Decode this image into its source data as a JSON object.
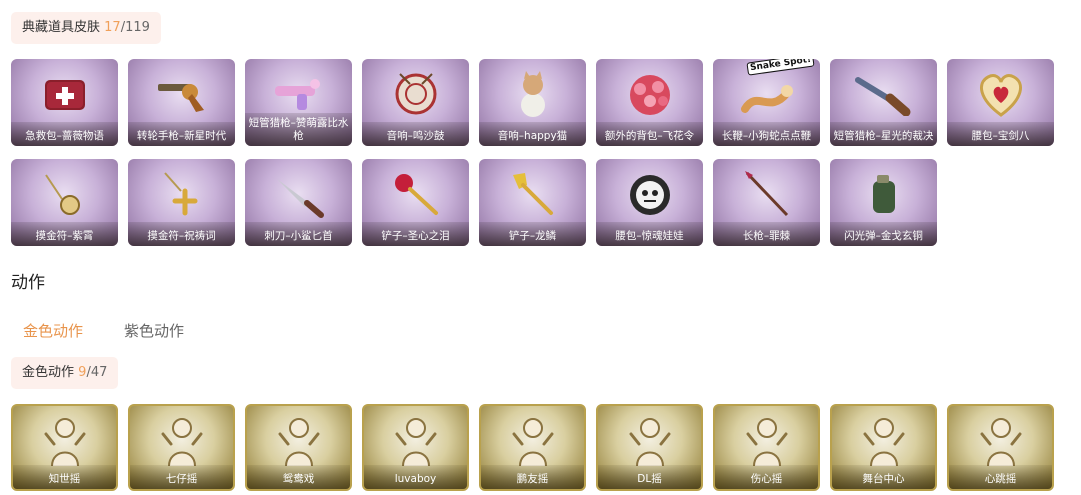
{
  "skins": {
    "title": "典藏道具皮肤",
    "count_current": "17",
    "count_total": "119",
    "row1": [
      {
        "label": "急救包–蔷薇物语",
        "icon": "first-aid-kit-icon"
      },
      {
        "label": "转轮手枪–新星时代",
        "icon": "revolver-icon"
      },
      {
        "label": "短管猎枪–赞萌露比水枪",
        "icon": "water-gun-icon"
      },
      {
        "label": "音响–鸣沙鼓",
        "icon": "drum-icon"
      },
      {
        "label": "音响–happy猫",
        "icon": "cat-icon"
      },
      {
        "label": "额外的背包–飞花令",
        "icon": "flower-backpack-icon"
      },
      {
        "label": "长鞭–小狗蛇点点鞭",
        "icon": "snake-whip-icon",
        "sticker": "Snake Spot!"
      },
      {
        "label": "短管猎枪–星光的裁决",
        "icon": "shotgun-icon"
      },
      {
        "label": "腰包–宝剑八",
        "icon": "heart-pouch-icon"
      }
    ],
    "row2": [
      {
        "label": "摸金符–紫霄",
        "icon": "charm-icon"
      },
      {
        "label": "摸金符–祝祷词",
        "icon": "cross-charm-icon"
      },
      {
        "label": "刺刀–小鲨匕首",
        "icon": "shark-dagger-icon"
      },
      {
        "label": "铲子–圣心之泪",
        "icon": "ruby-shovel-icon"
      },
      {
        "label": "铲子–龙鳞",
        "icon": "gold-shovel-icon"
      },
      {
        "label": "腰包–惊魂娃娃",
        "icon": "skull-pouch-icon"
      },
      {
        "label": "长枪–罪棘",
        "icon": "spear-icon"
      },
      {
        "label": "闪光弹–金戈玄铜",
        "icon": "grenade-icon"
      }
    ]
  },
  "actions": {
    "section_title": "动作",
    "tabs": [
      {
        "label": "金色动作",
        "active": true
      },
      {
        "label": "紫色动作",
        "active": false
      }
    ],
    "gold": {
      "title": "金色动作",
      "count_current": "9",
      "count_total": "47",
      "items": [
        {
          "label": "知世摇"
        },
        {
          "label": "七仔摇"
        },
        {
          "label": "鸳鸯戏"
        },
        {
          "label": "luvaboy"
        },
        {
          "label": "鹏友摇"
        },
        {
          "label": "DL摇"
        },
        {
          "label": "伤心摇"
        },
        {
          "label": "舞台中心"
        },
        {
          "label": "心跳摇"
        }
      ]
    }
  },
  "colors": {
    "accent_orange": "#e8944c",
    "badge_bg": "#fdf0ec",
    "purple_card": "#a88bb8",
    "gold_card": "#c9b868"
  }
}
